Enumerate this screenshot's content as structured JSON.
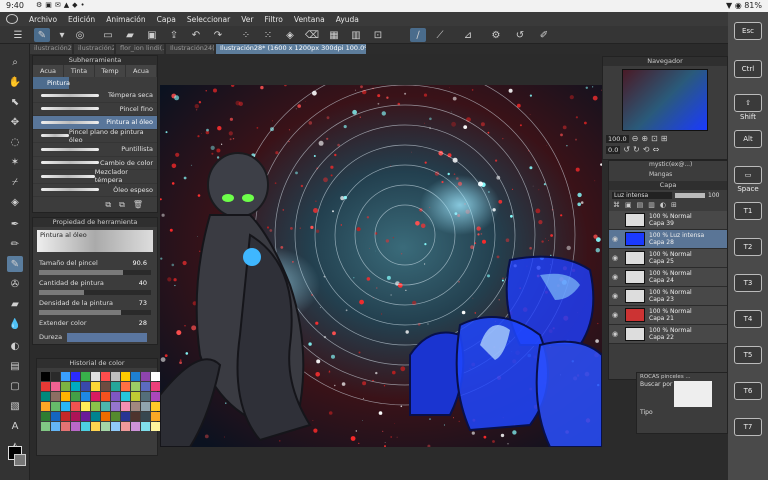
{
  "status": {
    "time": "9:40",
    "battery": "81%"
  },
  "menu": [
    "Archivo",
    "Edición",
    "Animación",
    "Capa",
    "Seleccionar",
    "Ver",
    "Filtro",
    "Ventana",
    "Ayuda"
  ],
  "tabs": [
    "ilustración20(...",
    "ilustración20(...",
    "flor_ion lindi(...",
    "Ilustración24(...",
    "Ilustración28* (1600 x 1200px 300dpi 100.0%)"
  ],
  "subtool": {
    "title": "Subherramienta",
    "tabs": [
      "Acua",
      "Tinta",
      "Temp",
      "Acua"
    ],
    "active_tab": "Pintura",
    "brushes": [
      {
        "label": "Témpera seca",
        "selected": false
      },
      {
        "label": "Pincel fino",
        "selected": false
      },
      {
        "label": "Pintura al óleo",
        "selected": true
      },
      {
        "label": "Pincel plano de pintura óleo",
        "selected": false
      },
      {
        "label": "Puntillista",
        "selected": false
      },
      {
        "label": "Cambio de color",
        "selected": false
      },
      {
        "label": "Mezclador témpera",
        "selected": false
      },
      {
        "label": "Óleo espeso",
        "selected": false
      }
    ]
  },
  "toolprop": {
    "title": "Propiedad de herramienta",
    "name": "Pintura al óleo",
    "props": [
      {
        "label": "Tamaño del pincel",
        "value": "90.6",
        "fill": 0.75
      },
      {
        "label": "Cantidad de pintura",
        "value": "40",
        "fill": 0.4
      },
      {
        "label": "Densidad de la pintura",
        "value": "73",
        "fill": 0.73
      },
      {
        "label": "Extender color",
        "value": "28",
        "fill": 0.28
      }
    ],
    "hardness_label": "Dureza"
  },
  "history": {
    "title": "Historial de color"
  },
  "navigator": {
    "title": "Navegador",
    "zoom": "100.0",
    "rotation": "0.0"
  },
  "layer_panel": {
    "title": "Capa",
    "blend": "Luz intensa",
    "opacity": "100",
    "top_rows": [
      "mystic(ex@...)",
      "Mangas"
    ],
    "layers": [
      {
        "mode": "100 % Normal",
        "name": "Capa 39",
        "selected": false
      },
      {
        "mode": "100 % Luz intensa",
        "name": "Capa 28",
        "selected": true
      },
      {
        "mode": "100 % Normal",
        "name": "Capa 25",
        "selected": false
      },
      {
        "mode": "100 % Normal",
        "name": "Capa 24",
        "selected": false
      },
      {
        "mode": "100 % Normal",
        "name": "Capa 23",
        "selected": false
      },
      {
        "mode": "100 % Normal",
        "name": "Capa 21",
        "selected": false
      },
      {
        "mode": "100 % Normal",
        "name": "Capa 22",
        "selected": false
      }
    ]
  },
  "material": {
    "label": "ROCAS pinceles ...",
    "search": "Buscar por",
    "tipo": "Tipo"
  },
  "keys": [
    {
      "label": "Esc"
    },
    {
      "label": "Ctrl"
    },
    {
      "label": "Shift",
      "glyph": "⇧"
    },
    {
      "label": "Alt"
    },
    {
      "label": "Space"
    },
    {
      "label": "T1"
    },
    {
      "label": "T2"
    },
    {
      "label": "T3"
    },
    {
      "label": "T4"
    },
    {
      "label": "T5"
    },
    {
      "label": "T6"
    },
    {
      "label": "T7"
    }
  ]
}
